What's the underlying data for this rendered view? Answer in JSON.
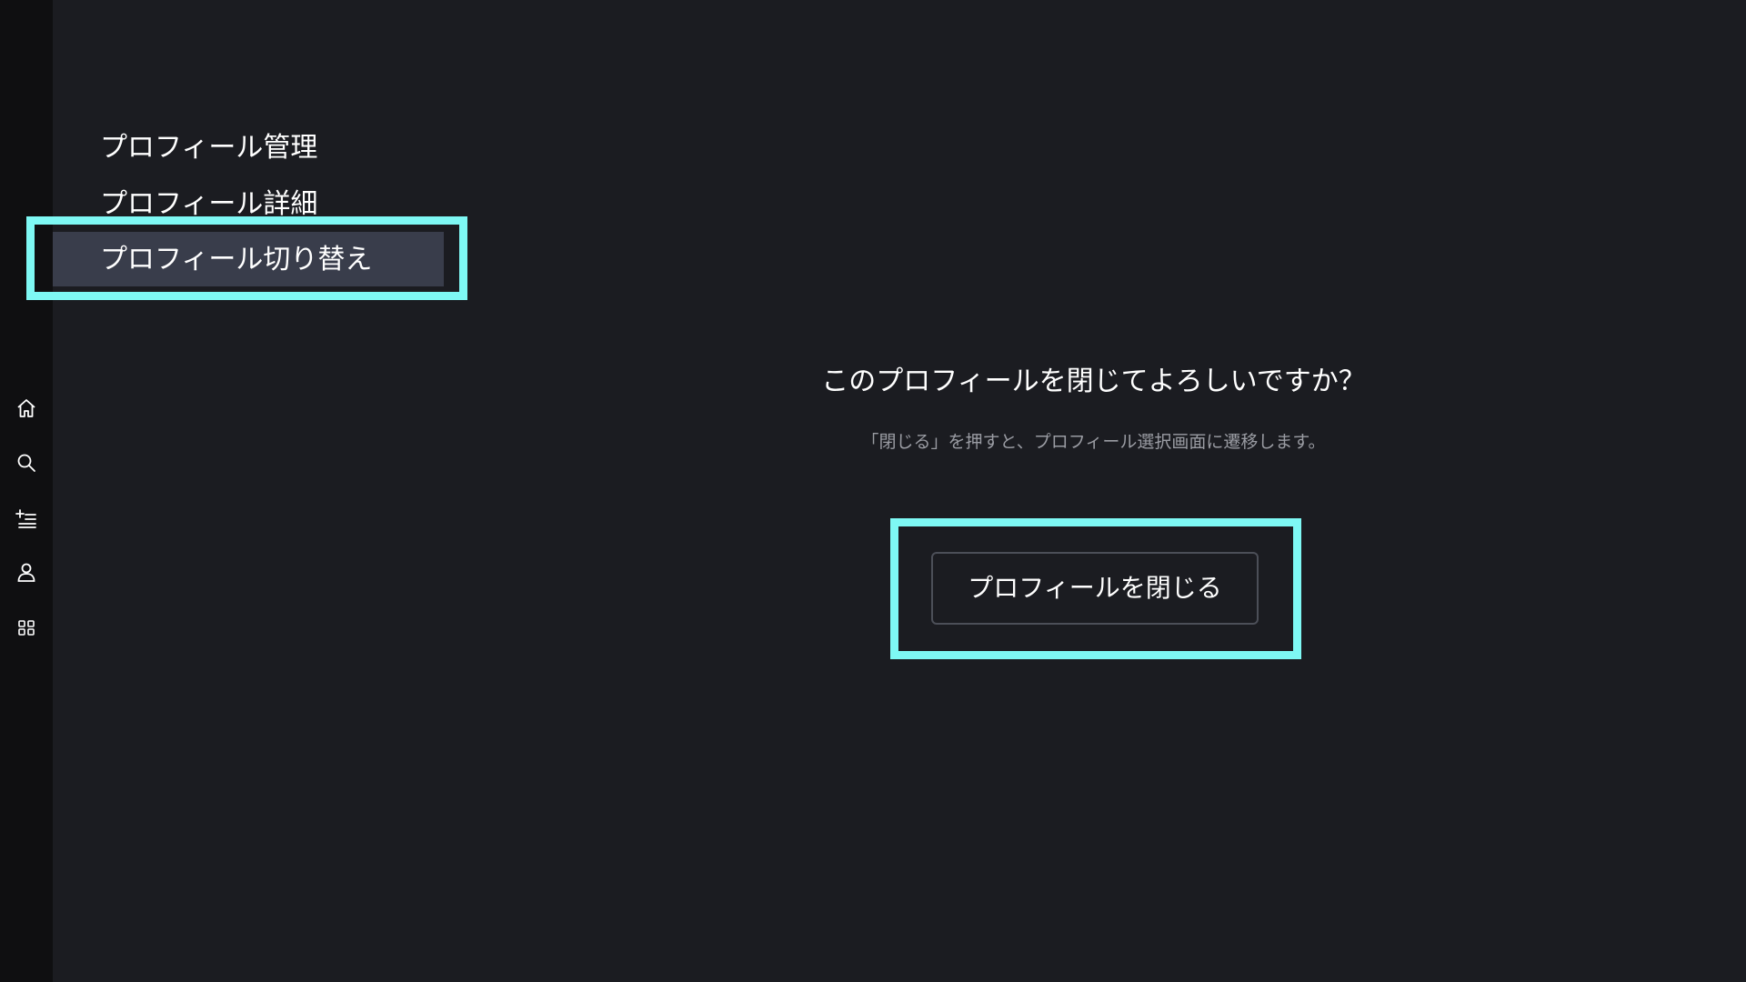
{
  "menu": {
    "items": [
      {
        "label": "プロフィール管理"
      },
      {
        "label": "プロフィール詳細"
      },
      {
        "label": "プロフィール切り替え",
        "selected": true
      }
    ]
  },
  "sidebar": {
    "icons": [
      "home-icon",
      "search-icon",
      "add-list-icon",
      "user-icon",
      "grid-icon"
    ]
  },
  "dialog": {
    "title": "このプロフィールを閉じてよろしいですか？",
    "subtitle": "「閉じる」を押すと、プロフィール選択画面に遷移します。",
    "close_button": "プロフィールを閉じる"
  },
  "colors": {
    "background": "#1b1c21",
    "rail": "#0f0f11",
    "focus": "#7ef8f4",
    "selected": "#393d4b",
    "subtext": "#9a9ca3"
  }
}
